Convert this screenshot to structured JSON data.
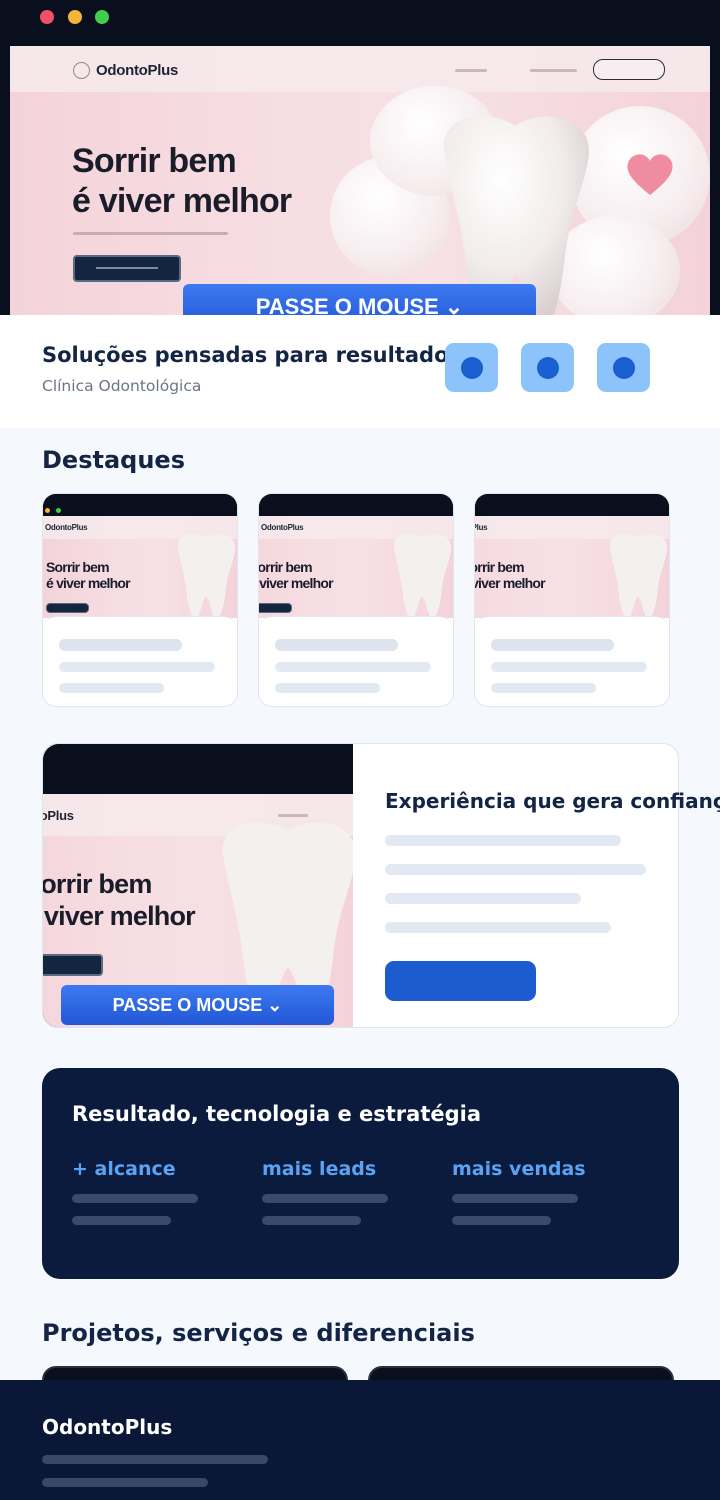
{
  "hero_mockup": {
    "brand": "OdontoPlus",
    "headline_line1": "Sorrir bem",
    "headline_line2": "é viver melhor",
    "overlay_button": "PASSE O MOUSE ⌄",
    "window_dots": [
      "#f0506a",
      "#f4b43a",
      "#3fcf4c"
    ]
  },
  "info_strip": {
    "title": "Soluções pensadas para resultados",
    "subtitle": "Clínica Odontológica",
    "icons": [
      "feature-icon",
      "feature-icon",
      "feature-icon"
    ]
  },
  "destaques": {
    "heading": "Destaques",
    "cards": [
      {
        "brand": "OdontoPlus",
        "line1": "Sorrir bem",
        "line2": "é viver melhor"
      },
      {
        "brand": "OdontoPlus",
        "line1": "Sorrir bem",
        "line2": "é viver melhor"
      },
      {
        "brand": "OdontoPlus",
        "line1": "Sorrir bem",
        "line2": "é viver melhor"
      }
    ]
  },
  "feature": {
    "title": "Experiência que gera confiança",
    "mockup_brand": "OdontoPlus",
    "mockup_line1": "Sorrir bem",
    "mockup_line2": "é viver melhor",
    "overlay_button": "PASSE O MOUSE ⌄"
  },
  "results": {
    "title": "Resultado, tecnologia e estratégia",
    "stats": [
      "+ alcance",
      "mais leads",
      "mais vendas"
    ]
  },
  "projects": {
    "heading": "Projetos, serviços e diferenciais"
  },
  "footer": {
    "brand": "OdontoPlus"
  },
  "colors": {
    "primary": "#1c5bd0",
    "navy": "#0b1b3e",
    "accent_light": "#8cc3fa",
    "stat_text": "#5aa2f4"
  }
}
